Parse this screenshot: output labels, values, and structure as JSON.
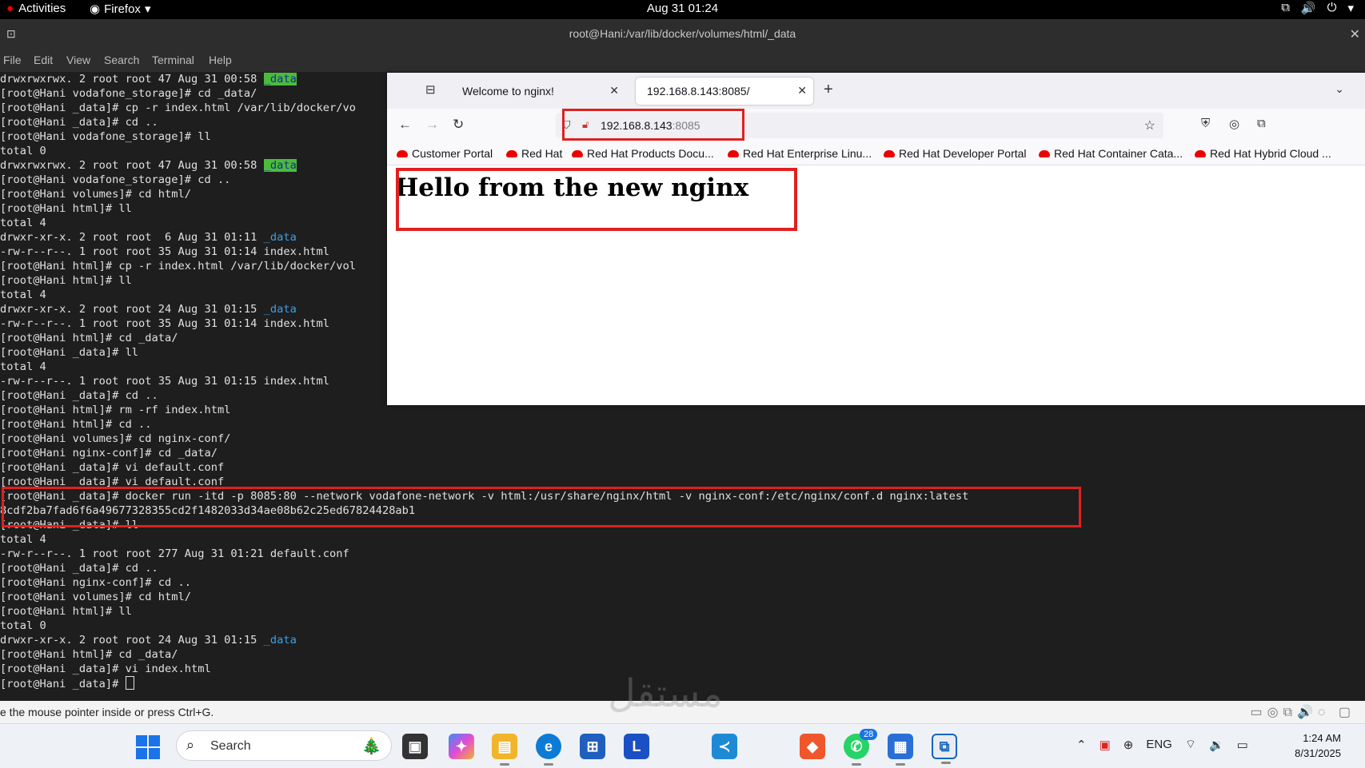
{
  "topbar": {
    "activities": "Activities",
    "app": "Firefox",
    "datetime": "Aug 31  01:24"
  },
  "terminal": {
    "title": "root@Hani:/var/lib/docker/volumes/html/_data",
    "menu": [
      "File",
      "Edit",
      "View",
      "Search",
      "Terminal",
      "Help"
    ],
    "lines": [
      {
        "t": "drwxrwxrwx. 2 root root 47 Aug 31 00:58 ",
        "d": "_data",
        "k": "hl"
      },
      {
        "t": "[root@Hani vodafone_storage]# cd _data/"
      },
      {
        "t": "[root@Hani _data]# cp -r index.html /var/lib/docker/vo"
      },
      {
        "t": "[root@Hani _data]# cd .."
      },
      {
        "t": "[root@Hani vodafone_storage]# ll"
      },
      {
        "t": "total 0"
      },
      {
        "t": "drwxrwxrwx. 2 root root 47 Aug 31 00:58 ",
        "d": "_data",
        "k": "hl"
      },
      {
        "t": "[root@Hani vodafone_storage]# cd .."
      },
      {
        "t": "[root@Hani volumes]# cd html/"
      },
      {
        "t": "[root@Hani html]# ll"
      },
      {
        "t": "total 4"
      },
      {
        "t": "drwxr-xr-x. 2 root root  6 Aug 31 01:11 ",
        "d": "_data",
        "k": "dir"
      },
      {
        "t": "-rw-r--r--. 1 root root 35 Aug 31 01:14 index.html"
      },
      {
        "t": "[root@Hani html]# cp -r index.html /var/lib/docker/vol"
      },
      {
        "t": "[root@Hani html]# ll"
      },
      {
        "t": "total 4"
      },
      {
        "t": "drwxr-xr-x. 2 root root 24 Aug 31 01:15 ",
        "d": "_data",
        "k": "dir"
      },
      {
        "t": "-rw-r--r--. 1 root root 35 Aug 31 01:14 index.html"
      },
      {
        "t": "[root@Hani html]# cd _data/"
      },
      {
        "t": "[root@Hani _data]# ll"
      },
      {
        "t": "total 4"
      },
      {
        "t": "-rw-r--r--. 1 root root 35 Aug 31 01:15 index.html"
      },
      {
        "t": "[root@Hani _data]# cd .."
      },
      {
        "t": "[root@Hani html]# rm -rf index.html"
      },
      {
        "t": "[root@Hani html]# cd .."
      },
      {
        "t": "[root@Hani volumes]# cd nginx-conf/"
      },
      {
        "t": "[root@Hani nginx-conf]# cd _data/"
      },
      {
        "t": "[root@Hani _data]# vi default.conf"
      },
      {
        "t": "[root@Hani _data]# vi default.conf"
      },
      {
        "t": "[root@Hani _data]# docker run -itd -p 8085:80 --network vodafone-network -v html:/usr/share/nginx/html -v nginx-conf:/etc/nginx/conf.d nginx:latest"
      },
      {
        "t": "8cdf2ba7fad6f6a49677328355cd2f1482033d34ae08b62c25ed67824428ab1"
      },
      {
        "t": "[root@Hani _data]# ll"
      },
      {
        "t": "total 4"
      },
      {
        "t": "-rw-r--r--. 1 root root 277 Aug 31 01:21 default.conf"
      },
      {
        "t": "[root@Hani _data]# cd .."
      },
      {
        "t": "[root@Hani nginx-conf]# cd .."
      },
      {
        "t": "[root@Hani volumes]# cd html/"
      },
      {
        "t": "[root@Hani html]# ll"
      },
      {
        "t": "total 0"
      },
      {
        "t": "drwxr-xr-x. 2 root root 24 Aug 31 01:15 ",
        "d": "_data",
        "k": "dir"
      },
      {
        "t": "[root@Hani html]# cd _data/"
      },
      {
        "t": "[root@Hani _data]# vi index.html"
      },
      {
        "t": "[root@Hani _data]# ",
        "cursor": true
      }
    ]
  },
  "browser": {
    "tabs": [
      {
        "label": "Welcome to nginx!"
      },
      {
        "label": "192.168.8.143:8085/"
      }
    ],
    "url_host": "192.168.8.143",
    "url_port": ":8085",
    "bookmarks": [
      "Customer Portal",
      "Red Hat",
      "Red Hat Products Docu...",
      "Red Hat Enterprise Linu...",
      "Red Hat Developer Portal",
      "Red Hat Container Cata...",
      "Red Hat Hybrid Cloud ..."
    ],
    "page_heading": "Hello from the new nginx"
  },
  "vm_status": {
    "text": "e the mouse pointer inside or press Ctrl+G."
  },
  "taskbar": {
    "search_label": "Search",
    "badge": "28",
    "language": "ENG",
    "time": "1:24 AM",
    "date": "8/31/2025"
  },
  "watermark": "مستقل"
}
